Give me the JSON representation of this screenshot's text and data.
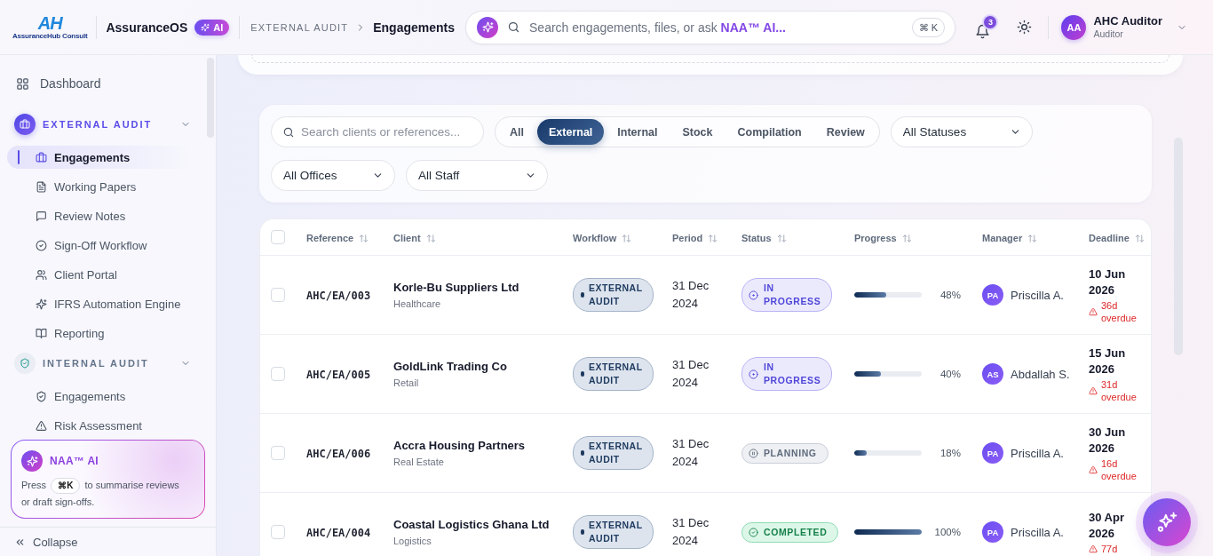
{
  "topbar": {
    "logo": {
      "mark": "AH",
      "caption": "AssuranceHub Consult"
    },
    "app_name": "AssuranceOS",
    "ai_badge": "AI",
    "breadcrumb": [
      "EXTERNAL AUDIT",
      "Engagements"
    ],
    "search": {
      "placeholder": "Search engagements, files, or ask **NAA™ AI...**",
      "shortcut": "⌘ K"
    },
    "notifications": {
      "count": "3"
    },
    "user": {
      "initials": "AA",
      "name": "AHC Auditor",
      "role": "Auditor"
    }
  },
  "sidebar": {
    "items": [
      {
        "kind": "link",
        "label": "Dashboard",
        "selected": false
      },
      {
        "kind": "section",
        "label": "EXTERNAL AUDIT",
        "active": true,
        "expanded": true,
        "children": [
          {
            "label": "Engagements",
            "selected": true
          },
          {
            "label": "Working Papers",
            "selected": false
          },
          {
            "label": "Review Notes",
            "selected": false
          },
          {
            "label": "Sign-Off Workflow",
            "selected": false
          },
          {
            "label": "Client Portal",
            "selected": false
          },
          {
            "label": "IFRS Automation Engine",
            "selected": false
          },
          {
            "label": "Reporting",
            "selected": false
          }
        ]
      },
      {
        "kind": "section",
        "label": "INTERNAL AUDIT",
        "active": false,
        "expanded": true,
        "children": [
          {
            "label": "Engagements",
            "selected": false
          },
          {
            "label": "Risk Assessment",
            "selected": false
          }
        ]
      }
    ],
    "ai_card": {
      "title": "NAA™ AI",
      "hint_before": "Press",
      "hint_key": "⌘K",
      "hint_after": "to summarise reviews or draft sign-offs."
    },
    "collapse": "Collapse"
  },
  "filters": {
    "search": {
      "placeholder": "Search clients or references..."
    },
    "type_tabs": [
      {
        "label": "All",
        "selected": false
      },
      {
        "label": "External",
        "selected": true
      },
      {
        "label": "Internal",
        "selected": false
      },
      {
        "label": "Stock",
        "selected": false
      },
      {
        "label": "Compilation",
        "selected": false
      },
      {
        "label": "Review",
        "selected": false
      }
    ],
    "dropdowns": [
      {
        "value": "All Statuses"
      },
      {
        "value": "All Offices"
      },
      {
        "value": "All Staff"
      }
    ]
  },
  "table": {
    "select_all": false,
    "columns": [
      {
        "label": "Reference"
      },
      {
        "label": "Client"
      },
      {
        "label": "Workflow"
      },
      {
        "label": "Period"
      },
      {
        "label": "Status"
      },
      {
        "label": "Progress"
      },
      {
        "label": "Manager"
      },
      {
        "label": "Deadline"
      }
    ],
    "rows": [
      {
        "selected": false,
        "reference": "AHC/EA/003",
        "client": "Korle-Bu Suppliers Ltd",
        "sector": "Healthcare",
        "workflow": "EXTERNAL AUDIT",
        "period": "31 Dec 2024",
        "status": {
          "kind": "in_progress",
          "label": "IN PROGRESS"
        },
        "progress": {
          "level": 0.48,
          "reading": "48%"
        },
        "manager": {
          "initials": "PA",
          "name": "Priscilla A."
        },
        "deadline": {
          "date": "10 Jun 2026",
          "overdue": "36d overdue"
        }
      },
      {
        "selected": false,
        "reference": "AHC/EA/005",
        "client": "GoldLink Trading Co",
        "sector": "Retail",
        "workflow": "EXTERNAL AUDIT",
        "period": "31 Dec 2024",
        "status": {
          "kind": "in_progress",
          "label": "IN PROGRESS"
        },
        "progress": {
          "level": 0.4,
          "reading": "40%"
        },
        "manager": {
          "initials": "AS",
          "name": "Abdallah S."
        },
        "deadline": {
          "date": "15 Jun 2026",
          "overdue": "31d overdue"
        }
      },
      {
        "selected": false,
        "reference": "AHC/EA/006",
        "client": "Accra Housing Partners",
        "sector": "Real Estate",
        "workflow": "EXTERNAL AUDIT",
        "period": "31 Dec 2024",
        "status": {
          "kind": "planning",
          "label": "PLANNING"
        },
        "progress": {
          "level": 0.18,
          "reading": "18%"
        },
        "manager": {
          "initials": "PA",
          "name": "Priscilla A."
        },
        "deadline": {
          "date": "30 Jun 2026",
          "overdue": "16d overdue"
        }
      },
      {
        "selected": false,
        "reference": "AHC/EA/004",
        "client": "Coastal Logistics Ghana Ltd",
        "sector": "Logistics",
        "workflow": "EXTERNAL AUDIT",
        "period": "31 Dec 2024",
        "status": {
          "kind": "completed",
          "label": "COMPLETED"
        },
        "progress": {
          "level": 1,
          "reading": "100%"
        },
        "manager": {
          "initials": "PA",
          "name": "Priscilla A."
        },
        "deadline": {
          "date": "30 Apr 2026",
          "overdue": "77d"
        }
      }
    ]
  }
}
